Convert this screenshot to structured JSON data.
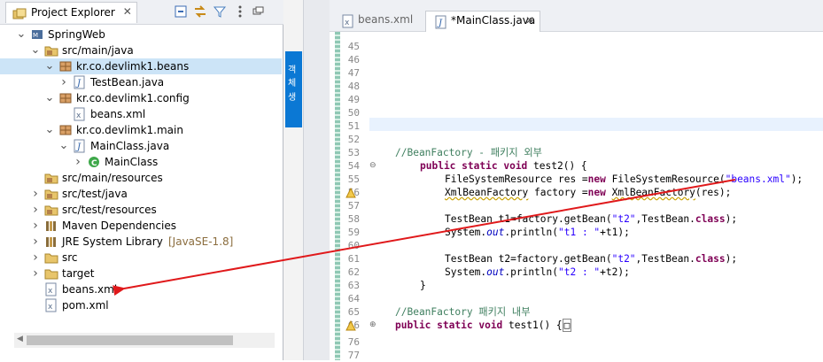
{
  "explorer": {
    "title": "Project Explorer",
    "close_glyph": "✕",
    "toolbar": [
      "collapse-all-icon",
      "link-editor-icon",
      "filter-icon",
      "view-menu-icon",
      "minimize-icon"
    ],
    "tree": [
      {
        "label": "SpringWeb",
        "icon": "maven-project-icon",
        "expanded": true
      },
      {
        "label": "src/main/java",
        "icon": "source-folder-icon",
        "expanded": true
      },
      {
        "label": "kr.co.devlimk1.beans",
        "icon": "package-icon",
        "expanded": true,
        "selected": true
      },
      {
        "label": "TestBean.java",
        "icon": "java-file-icon",
        "expanded": false
      },
      {
        "label": "kr.co.devlimk1.config",
        "icon": "package-icon",
        "expanded": true
      },
      {
        "label": "beans.xml",
        "icon": "xml-file-icon"
      },
      {
        "label": "kr.co.devlimk1.main",
        "icon": "package-icon",
        "expanded": true
      },
      {
        "label": "MainClass.java",
        "icon": "java-file-icon",
        "expanded": true
      },
      {
        "label": "MainClass",
        "icon": "class-icon",
        "expanded": false
      },
      {
        "label": "src/main/resources",
        "icon": "source-folder-icon"
      },
      {
        "label": "src/test/java",
        "icon": "source-folder-icon",
        "expanded": false
      },
      {
        "label": "src/test/resources",
        "icon": "source-folder-icon",
        "expanded": false
      },
      {
        "label": "Maven Dependencies",
        "icon": "library-icon",
        "expanded": false
      },
      {
        "label": "JRE System Library",
        "decoration": "[JavaSE-1.8]",
        "icon": "library-icon",
        "expanded": false
      },
      {
        "label": "src",
        "icon": "folder-icon",
        "expanded": false
      },
      {
        "label": "target",
        "icon": "folder-icon",
        "expanded": false
      },
      {
        "label": "beans.xml",
        "icon": "xml-file-icon"
      },
      {
        "label": "pom.xml",
        "icon": "xml-file-icon"
      }
    ]
  },
  "side_panel": {
    "text1": "객체",
    "text2": "생"
  },
  "editor": {
    "tabs": [
      {
        "label": "beans.xml",
        "active": false
      },
      {
        "label": "*MainClass.java",
        "active": true
      }
    ],
    "close_glyph": "✕",
    "line_numbers": [
      "45",
      "46",
      "47",
      "48",
      "49",
      "50",
      "51",
      "52",
      "53",
      "54",
      "55",
      "56",
      "57",
      "58",
      "59",
      "60",
      "61",
      "62",
      "63",
      "64",
      "65",
      "66",
      "76",
      "77"
    ],
    "code": {
      "l53": "//BeanFactory - 패키지 외부",
      "l54_kw1": "public",
      "l54_kw2": "static",
      "l54_kw3": "void",
      "l54_rest": " test2() {",
      "l55_a": "FileSystemResource res =",
      "l55_kw": "new",
      "l55_b": " FileSystemResource(",
      "l55_str": "\"beans.xml\"",
      "l55_c": ");",
      "l56_type": "XmlBeanFactory",
      "l56_a": " factory =",
      "l56_kw": "new",
      "l56_ctor": "XmlBeanFactory",
      "l56_b": "(res);",
      "l58_a": "TestBean t1=factory.getBean(",
      "l58_str": "\"t2\"",
      "l58_b": ",TestBean.",
      "l58_kw": "class",
      "l58_c": ");",
      "l59_a": "System.",
      "l59_out": "out",
      "l59_b": ".println(",
      "l59_str": "\"t1 : \"",
      "l59_c": "+t1);",
      "l61_a": "TestBean t2=factory.getBean(",
      "l61_str": "\"t2\"",
      "l61_b": ",TestBean.",
      "l61_kw": "class",
      "l61_c": ");",
      "l62_a": "System.",
      "l62_out": "out",
      "l62_b": ".println(",
      "l62_str": "\"t2 : \"",
      "l62_c": "+t2);",
      "l63": "}",
      "l65": "//BeanFactory 패키지 내부",
      "l66_kw1": "public",
      "l66_kw2": "static",
      "l66_kw3": "void",
      "l66_rest": " test1() {",
      "l66_box": "□"
    }
  },
  "colors": {
    "keyword": "#7f0055",
    "comment": "#3f7f5f",
    "string": "#2a00ff",
    "field": "#0000c0",
    "selection": "#cce4f7",
    "arrow": "#e0191b"
  }
}
